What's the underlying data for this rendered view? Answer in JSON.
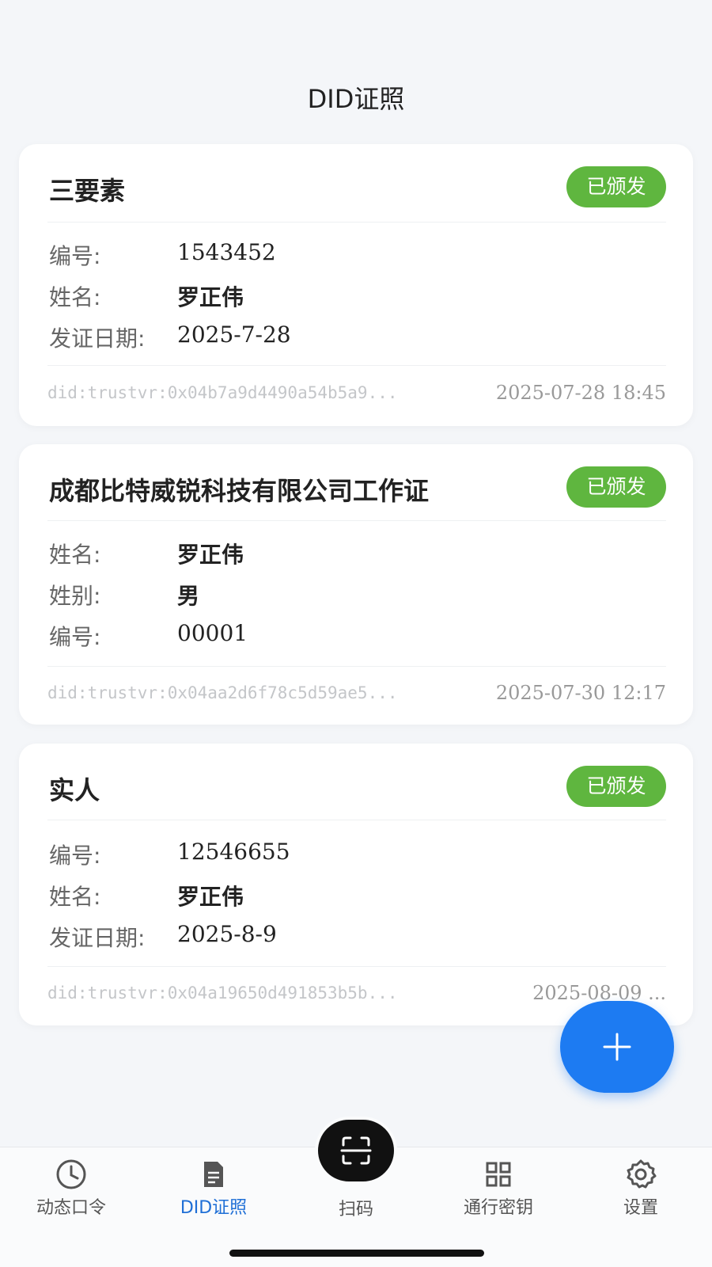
{
  "header": {
    "title": "DID证照"
  },
  "cards": [
    {
      "title": "三要素",
      "status": "已颁发",
      "fields": [
        {
          "label": "编号:",
          "value": "1543452",
          "bold": false
        },
        {
          "label": "姓名:",
          "value": "罗正伟",
          "bold": true
        },
        {
          "label": "发证日期:",
          "value": "2025-7-28",
          "bold": false
        }
      ],
      "did": "did:trustvr:0x04b7a9d4490a54b5a9...",
      "timestamp": "2025-07-28 18:45"
    },
    {
      "title": "成都比特威锐科技有限公司工作证",
      "status": "已颁发",
      "fields": [
        {
          "label": "姓名:",
          "value": "罗正伟",
          "bold": true
        },
        {
          "label": "姓别:",
          "value": "男",
          "bold": true
        },
        {
          "label": "编号:",
          "value": "00001",
          "bold": false
        }
      ],
      "did": "did:trustvr:0x04aa2d6f78c5d59ae5...",
      "timestamp": "2025-07-30 12:17"
    },
    {
      "title": "实人",
      "status": "已颁发",
      "fields": [
        {
          "label": "编号:",
          "value": "12546655",
          "bold": false
        },
        {
          "label": "姓名:",
          "value": "罗正伟",
          "bold": true
        },
        {
          "label": "发证日期:",
          "value": "2025-8-9",
          "bold": false
        }
      ],
      "did": "did:trustvr:0x04a19650d491853b5b...",
      "timestamp": "2025-08-09 ..."
    }
  ],
  "fab": {
    "icon": "plus-icon"
  },
  "tabbar": {
    "tabs": [
      {
        "label": "动态口令",
        "icon": "clock-icon",
        "active": false
      },
      {
        "label": "DID证照",
        "icon": "document-icon",
        "active": true
      },
      {
        "label": "扫码",
        "icon": "scan-icon",
        "active": false
      },
      {
        "label": "通行密钥",
        "icon": "grid-icon",
        "active": false
      },
      {
        "label": "设置",
        "icon": "gear-icon",
        "active": false
      }
    ]
  },
  "colors": {
    "accent": "#1d7bf2",
    "badge_green": "#5fb63f",
    "active_tab": "#1f6fd6"
  }
}
